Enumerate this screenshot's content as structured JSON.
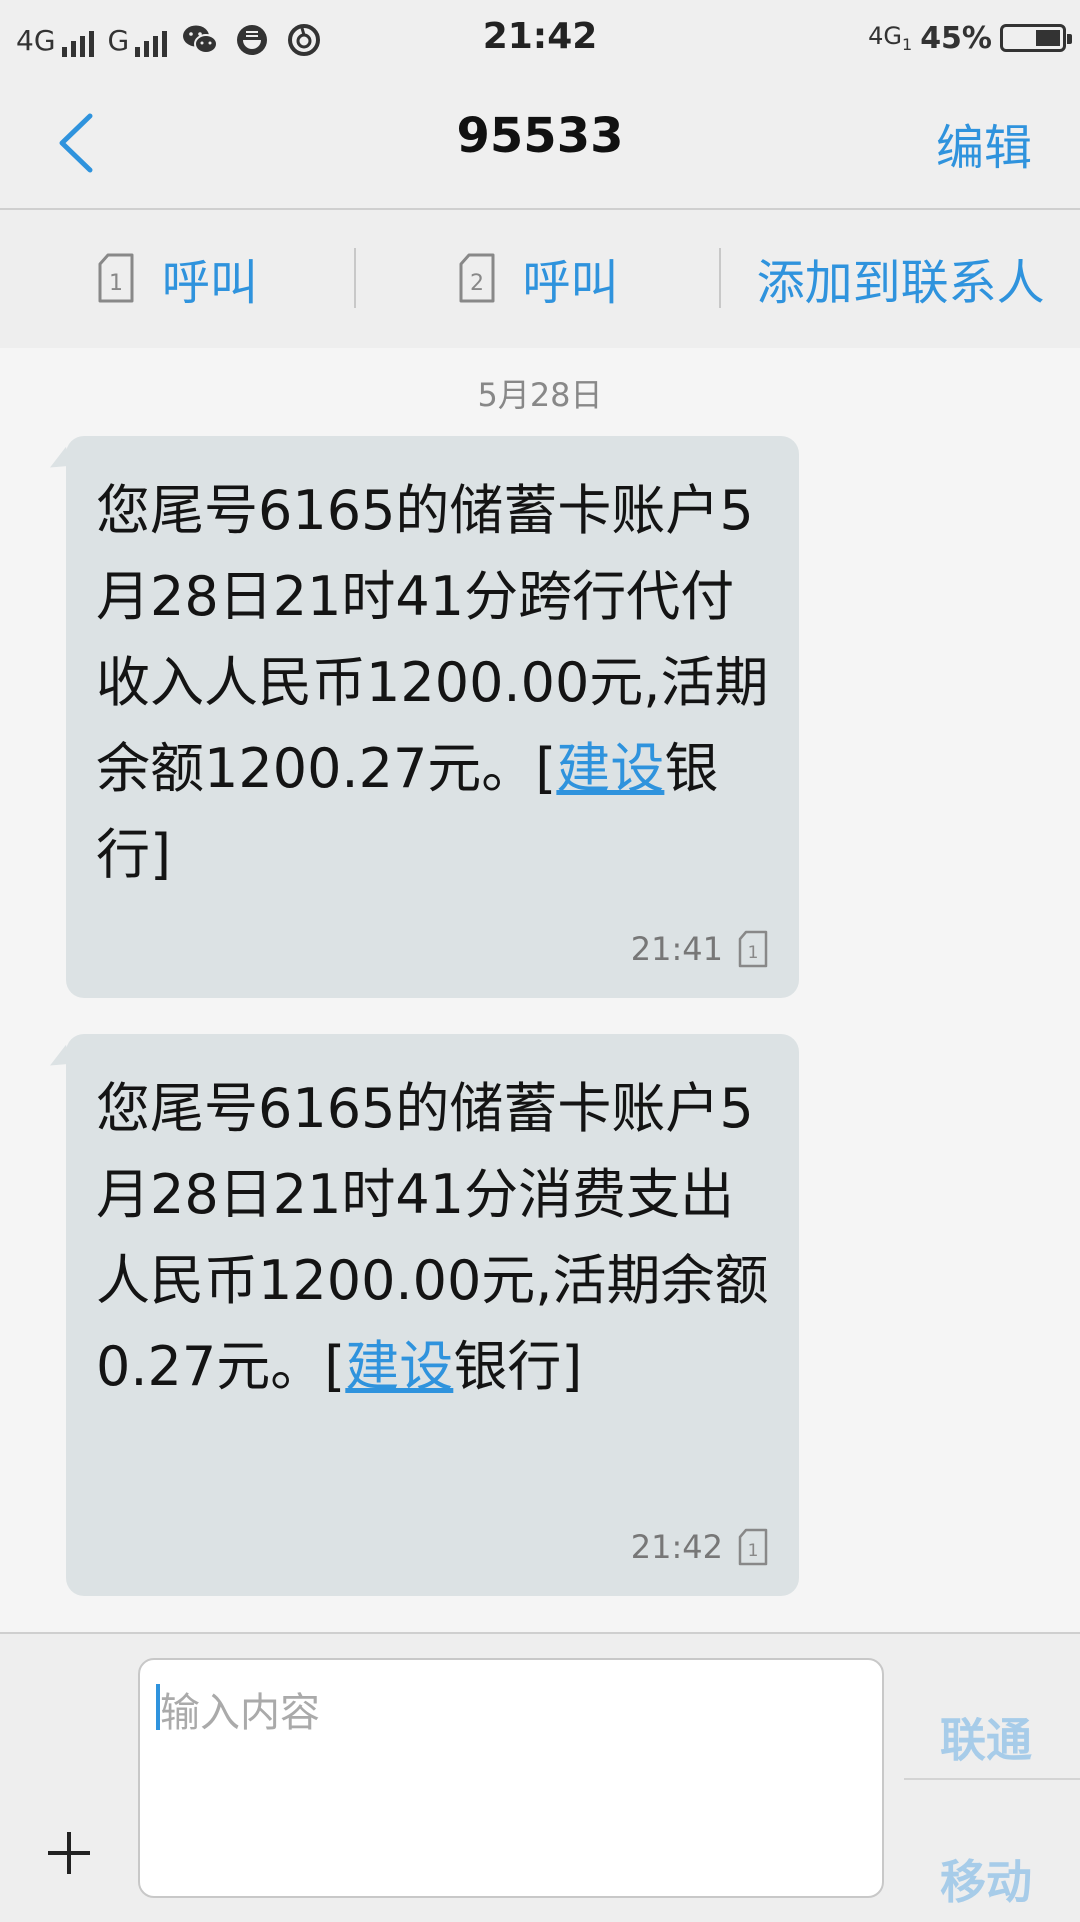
{
  "status_bar": {
    "network1": "4G",
    "network2": "G",
    "time": "21:42",
    "net_right": "4G",
    "net_sub": "1",
    "battery_percent": "45%",
    "battery_level": 0.45,
    "icons": [
      "wechat-icon",
      "noodle-app-icon",
      "netease-music-icon"
    ]
  },
  "header": {
    "title": "95533",
    "edit_label": "编辑"
  },
  "actions": {
    "call1_sim": "1",
    "call1_label": "呼叫",
    "call2_sim": "2",
    "call2_label": "呼叫",
    "add_contact_label": "添加到联系人"
  },
  "conversation": {
    "date": "5月28日",
    "messages": [
      {
        "text": "您尾号6165的储蓄卡账户5月28日21时41分跨行代付收入人民币1200.00元,活期余额1200.27元。[",
        "link": "建设",
        "tail": "银行]",
        "time": "21:41",
        "sim": "1"
      },
      {
        "text": "您尾号6165的储蓄卡账户5月28日21时41分消费支出人民币1200.00元,活期余额0.27元。[",
        "link": "建设",
        "tail": "银行]",
        "time": "21:42",
        "sim": "1"
      }
    ]
  },
  "input": {
    "placeholder": "输入内容",
    "send_unicom": "联通",
    "send_mobile": "移动"
  },
  "colors": {
    "accent": "#2f93dd",
    "bubble": "#dce2e4",
    "sim_send_disabled": "#a7cce9"
  }
}
